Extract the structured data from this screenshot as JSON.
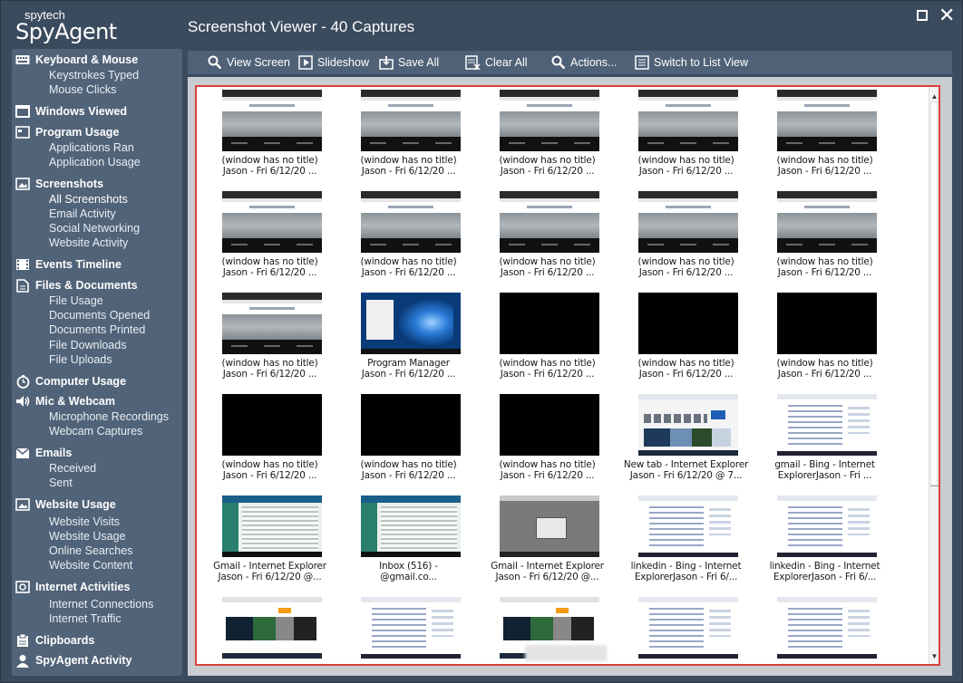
{
  "app": {
    "brand_small": "spytech",
    "brand_big": "SpyAgent",
    "title": "Screenshot Viewer - 40 Captures"
  },
  "sidebar": {
    "sections": [
      {
        "label": "Keyboard & Mouse",
        "icon": "keyboard-icon",
        "items": [
          "Keystrokes Typed",
          "Mouse Clicks"
        ]
      },
      {
        "label": "Windows Viewed",
        "icon": "windows-icon",
        "items": []
      },
      {
        "label": "Program Usage",
        "icon": "program-window-icon",
        "items": [
          "Applications Ran",
          "Application Usage"
        ]
      },
      {
        "label": "Screenshots",
        "icon": "screenshot-icon",
        "items": [
          "All Screenshots",
          "Email Activity",
          "Social Networking",
          "Website Activity"
        ]
      },
      {
        "label": "Events Timeline",
        "icon": "film-icon",
        "items": []
      },
      {
        "label": "Files & Documents",
        "icon": "document-icon",
        "items": [
          "File Usage",
          "Documents Opened",
          "Documents Printed",
          "File Downloads",
          "File Uploads"
        ]
      },
      {
        "label": "Computer Usage",
        "icon": "clock-icon",
        "items": []
      },
      {
        "label": "Mic & Webcam",
        "icon": "speaker-icon",
        "items": [
          "Microphone Recordings",
          "Webcam Captures"
        ]
      },
      {
        "label": "Emails",
        "icon": "email-icon",
        "items": [
          "Received",
          "Sent"
        ]
      },
      {
        "label": "Website Usage",
        "icon": "image-icon",
        "items": [
          "Website Visits",
          "Website Usage",
          "Online Searches",
          "Website Content"
        ]
      },
      {
        "label": "Internet Activities",
        "icon": "network-icon",
        "items": [
          "Internet Connections",
          "Internet Traffic"
        ]
      },
      {
        "label": "Clipboards",
        "icon": "clipboard-icon",
        "items": []
      },
      {
        "label": "SpyAgent Activity",
        "icon": "person-icon",
        "items": []
      }
    ]
  },
  "toolbar": {
    "view_screen": "View Screen",
    "slideshow": "Slideshow",
    "save_all": "Save All",
    "clear_all": "Clear All",
    "actions": "Actions...",
    "switch_view": "Switch to List View"
  },
  "captures": [
    {
      "line1": "(window has no title)",
      "line2": "Jason - Fri  6/12/20 ...",
      "thumb": "web"
    },
    {
      "line1": "(window has no title)",
      "line2": "Jason - Fri  6/12/20 ...",
      "thumb": "web"
    },
    {
      "line1": "(window has no title)",
      "line2": "Jason - Fri  6/12/20 ...",
      "thumb": "web"
    },
    {
      "line1": "(window has no title)",
      "line2": "Jason - Fri  6/12/20 ...",
      "thumb": "web"
    },
    {
      "line1": "(window has no title)",
      "line2": "Jason - Fri  6/12/20 ...",
      "thumb": "web"
    },
    {
      "line1": "(window has no title)",
      "line2": "Jason - Fri  6/12/20 ...",
      "thumb": "web"
    },
    {
      "line1": "(window has no title)",
      "line2": "Jason - Fri  6/12/20 ...",
      "thumb": "web"
    },
    {
      "line1": "(window has no title)",
      "line2": "Jason - Fri  6/12/20 ...",
      "thumb": "web"
    },
    {
      "line1": "(window has no title)",
      "line2": "Jason - Fri  6/12/20 ...",
      "thumb": "web"
    },
    {
      "line1": "(window has no title)",
      "line2": "Jason - Fri  6/12/20 ...",
      "thumb": "web"
    },
    {
      "line1": "(window has no title)",
      "line2": "Jason - Fri  6/12/20 ...",
      "thumb": "web"
    },
    {
      "line1": "Program Manager",
      "line2": "Jason - Fri  6/12/20 ...",
      "thumb": "win"
    },
    {
      "line1": "(window has no title)",
      "line2": "Jason - Fri  6/12/20 ...",
      "thumb": "black"
    },
    {
      "line1": "(window has no title)",
      "line2": "Jason - Fri  6/12/20 ...",
      "thumb": "black"
    },
    {
      "line1": "(window has no title)",
      "line2": "Jason - Fri  6/12/20 ...",
      "thumb": "black"
    },
    {
      "line1": "(window has no title)",
      "line2": "Jason - Fri  6/12/20 ...",
      "thumb": "black"
    },
    {
      "line1": "(window has no title)",
      "line2": "Jason - Fri  6/12/20 ...",
      "thumb": "black"
    },
    {
      "line1": "(window has no title)",
      "line2": "Jason - Fri  6/12/20 ...",
      "thumb": "black"
    },
    {
      "line1": "New tab - Internet Explorer",
      "line2": "Jason - Fri  6/12/20 @ 7...",
      "thumb": "ie"
    },
    {
      "line1": "gmail - Bing - Internet",
      "line2": "ExplorerJason - Fri  ...",
      "thumb": "bing"
    },
    {
      "line1": "Gmail - Internet Explorer",
      "line2": "Jason - Fri  6/12/20 @...",
      "thumb": "gmail"
    },
    {
      "line1": "Inbox (516) -",
      "line2": "@gmail.co...",
      "thumb": "gmail"
    },
    {
      "line1": "Gmail - Internet Explorer",
      "line2": "Jason - Fri  6/12/20 @...",
      "thumb": "gray"
    },
    {
      "line1": "linkedin - Bing - Internet",
      "line2": "ExplorerJason - Fri  6/...",
      "thumb": "bing"
    },
    {
      "line1": "linkedin - Bing - Internet",
      "line2": "ExplorerJason - Fri  6/...",
      "thumb": "bing"
    },
    {
      "line1": "",
      "line2": "",
      "thumb": "mixed"
    },
    {
      "line1": "",
      "line2": "",
      "thumb": "bing"
    },
    {
      "line1": "",
      "line2": "",
      "thumb": "mixed"
    },
    {
      "line1": "",
      "line2": "",
      "thumb": "bing"
    },
    {
      "line1": "",
      "line2": "",
      "thumb": "bing"
    }
  ]
}
